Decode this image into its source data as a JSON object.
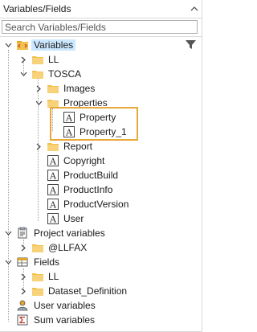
{
  "panel": {
    "title": "Variables/Fields"
  },
  "search": {
    "placeholder": "Search Variables/Fields"
  },
  "tree": [
    {
      "key": "variables",
      "label": "Variables",
      "icon": "variables-icon"
    },
    {
      "key": "ll",
      "label": "LL",
      "icon": "folder-icon"
    },
    {
      "key": "tosca",
      "label": "TOSCA",
      "icon": "folder-icon"
    },
    {
      "key": "images",
      "label": "Images",
      "icon": "folder-icon"
    },
    {
      "key": "properties",
      "label": "Properties",
      "icon": "folder-icon"
    },
    {
      "key": "property",
      "label": "Property",
      "icon": "text-variable-icon"
    },
    {
      "key": "property_1",
      "label": "Property_1",
      "icon": "text-variable-icon"
    },
    {
      "key": "report",
      "label": "Report",
      "icon": "folder-icon"
    },
    {
      "key": "copyright",
      "label": "Copyright",
      "icon": "text-variable-icon"
    },
    {
      "key": "productbuild",
      "label": "ProductBuild",
      "icon": "text-variable-icon"
    },
    {
      "key": "productinfo",
      "label": "ProductInfo",
      "icon": "text-variable-icon"
    },
    {
      "key": "productversion",
      "label": "ProductVersion",
      "icon": "text-variable-icon"
    },
    {
      "key": "user",
      "label": "User",
      "icon": "text-variable-icon"
    },
    {
      "key": "project_variables",
      "label": "Project variables",
      "icon": "project-variables-icon"
    },
    {
      "key": "llfax",
      "label": "@LLFAX",
      "icon": "folder-icon"
    },
    {
      "key": "fields",
      "label": "Fields",
      "icon": "fields-icon"
    },
    {
      "key": "fields_ll",
      "label": "LL",
      "icon": "folder-icon"
    },
    {
      "key": "dataset_definition",
      "label": "Dataset_Definition",
      "icon": "folder-icon"
    },
    {
      "key": "user_variables",
      "label": "User variables",
      "icon": "user-variables-icon"
    },
    {
      "key": "sum_variables",
      "label": "Sum variables",
      "icon": "sum-variables-icon"
    }
  ],
  "colors": {
    "accent": "#e8a93b",
    "folder": "#f2c14e",
    "selection": "#cce8ff"
  }
}
